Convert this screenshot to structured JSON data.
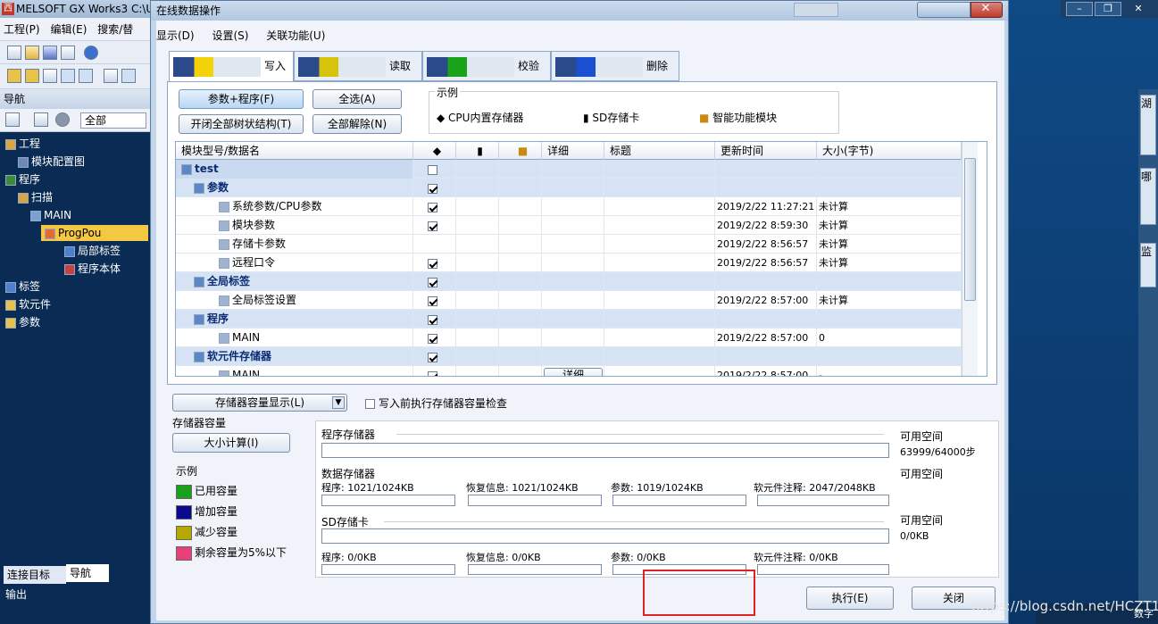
{
  "app": {
    "title": "MELSOFT GX Works3 C:\\U",
    "logo": "西",
    "menu": [
      "工程(P)",
      "编辑(E)",
      "搜索/替"
    ],
    "win_controls": [
      "–",
      "❐",
      "✕"
    ]
  },
  "nav": {
    "header": "导航",
    "filter_value": "全部",
    "tree": [
      {
        "label": "工程"
      },
      {
        "label": "模块配置图"
      },
      {
        "label": "程序"
      },
      {
        "label": "扫描"
      },
      {
        "label": "MAIN"
      },
      {
        "label": "ProgPou"
      },
      {
        "label": "局部标签"
      },
      {
        "label": "程序本体"
      },
      {
        "label": "标签"
      },
      {
        "label": "软元件"
      },
      {
        "label": "参数"
      }
    ],
    "bottom_tabs": [
      "连接目标",
      "导航"
    ],
    "output_label": "输出"
  },
  "dialog": {
    "title": "在线数据操作",
    "menu": [
      "显示(D)",
      "设置(S)",
      "关联功能(U)"
    ],
    "tabs": [
      {
        "label": "写入",
        "active": true,
        "color": "#e8c60a"
      },
      {
        "label": "读取",
        "active": false,
        "color": "#d9c60a"
      },
      {
        "label": "校验",
        "active": false,
        "color": "#1aa31a"
      },
      {
        "label": "删除",
        "active": false,
        "color": "#1b4fd1"
      }
    ],
    "buttons": {
      "param_prog": "参数+程序(F)",
      "select_all": "全选(A)",
      "expand_tree": "开闭全部树状结构(T)",
      "deselect_all": "全部解除(N)"
    },
    "legend": {
      "caption": "示例",
      "items": [
        "CPU内置存储器",
        "SD存储卡",
        "智能功能模块"
      ]
    },
    "grid": {
      "headers": [
        "模块型号/数据名",
        "",
        "",
        "",
        "详细",
        "标题",
        "更新时间",
        "大小(字节)"
      ],
      "rows": [
        {
          "name": "test",
          "bold": true,
          "group": true,
          "indent": 0,
          "check": "off",
          "detail": "",
          "time": "",
          "size": ""
        },
        {
          "name": "参数",
          "bold": true,
          "group": true,
          "indent": 1,
          "check": "on",
          "detail": "",
          "time": "",
          "size": ""
        },
        {
          "name": "系统参数/CPU参数",
          "bold": false,
          "group": false,
          "indent": 3,
          "check": "on",
          "detail": "",
          "time": "2019/2/22 11:27:21",
          "size": "未计算"
        },
        {
          "name": "模块参数",
          "bold": false,
          "group": false,
          "indent": 3,
          "check": "on",
          "detail": "",
          "time": "2019/2/22 8:59:30",
          "size": "未计算"
        },
        {
          "name": "存储卡参数",
          "bold": false,
          "group": false,
          "indent": 3,
          "check": "none",
          "detail": "",
          "time": "2019/2/22 8:56:57",
          "size": "未计算"
        },
        {
          "name": "远程口令",
          "bold": false,
          "group": false,
          "indent": 3,
          "check": "on",
          "detail": "",
          "time": "2019/2/22 8:56:57",
          "size": "未计算"
        },
        {
          "name": "全局标签",
          "bold": true,
          "group": true,
          "indent": 1,
          "check": "on",
          "detail": "",
          "time": "",
          "size": ""
        },
        {
          "name": "全局标签设置",
          "bold": false,
          "group": false,
          "indent": 3,
          "check": "on",
          "detail": "",
          "time": "2019/2/22 8:57:00",
          "size": "未计算"
        },
        {
          "name": "程序",
          "bold": true,
          "group": true,
          "indent": 1,
          "check": "on",
          "detail": "",
          "time": "",
          "size": ""
        },
        {
          "name": "MAIN",
          "bold": false,
          "group": false,
          "indent": 3,
          "check": "on",
          "detail": "",
          "time": "2019/2/22 8:57:00",
          "size": "0"
        },
        {
          "name": "软元件存储器",
          "bold": true,
          "group": true,
          "indent": 1,
          "check": "on",
          "detail": "",
          "time": "",
          "size": ""
        },
        {
          "name": "MAIN",
          "bold": false,
          "group": false,
          "indent": 3,
          "check": "on",
          "detail": "详细",
          "time": "2019/2/22 8:57:00",
          "size": "-"
        }
      ]
    },
    "capacity": {
      "toggle_label": "存储器容量显示(L)",
      "check_label": "写入前执行存储器容量检查",
      "section_label": "存储器容量",
      "calc_button": "大小计算(I)",
      "legend_caption": "示例",
      "legend": [
        {
          "label": "已用容量",
          "color": "#1aa01a"
        },
        {
          "label": "增加容量",
          "color": "#0a0a8c"
        },
        {
          "label": "减少容量",
          "color": "#b5a800"
        },
        {
          "label": "剩余容量为5%以下",
          "color": "#e8417a"
        }
      ],
      "program_storage": "程序存储器",
      "free_space": "可用空间",
      "program_free": "63999/64000步",
      "data_storage": "数据存储器",
      "data_items": [
        "程序: 1021/1024KB",
        "恢复信息: 1021/1024KB",
        "参数: 1019/1024KB",
        "软元件注释: 2047/2048KB"
      ],
      "sd_card": "SD存储卡",
      "sd_free": "0/0KB",
      "sd_items": [
        "程序: 0/0KB",
        "恢复信息: 0/0KB",
        "参数: 0/0KB",
        "软元件注释: 0/0KB"
      ]
    },
    "execute": "执行(E)",
    "close": "关闭"
  },
  "watermark": "https://blog.csdn.net/HCZT1",
  "status": "数字",
  "right_strip": [
    "湖",
    "哪",
    "监"
  ]
}
